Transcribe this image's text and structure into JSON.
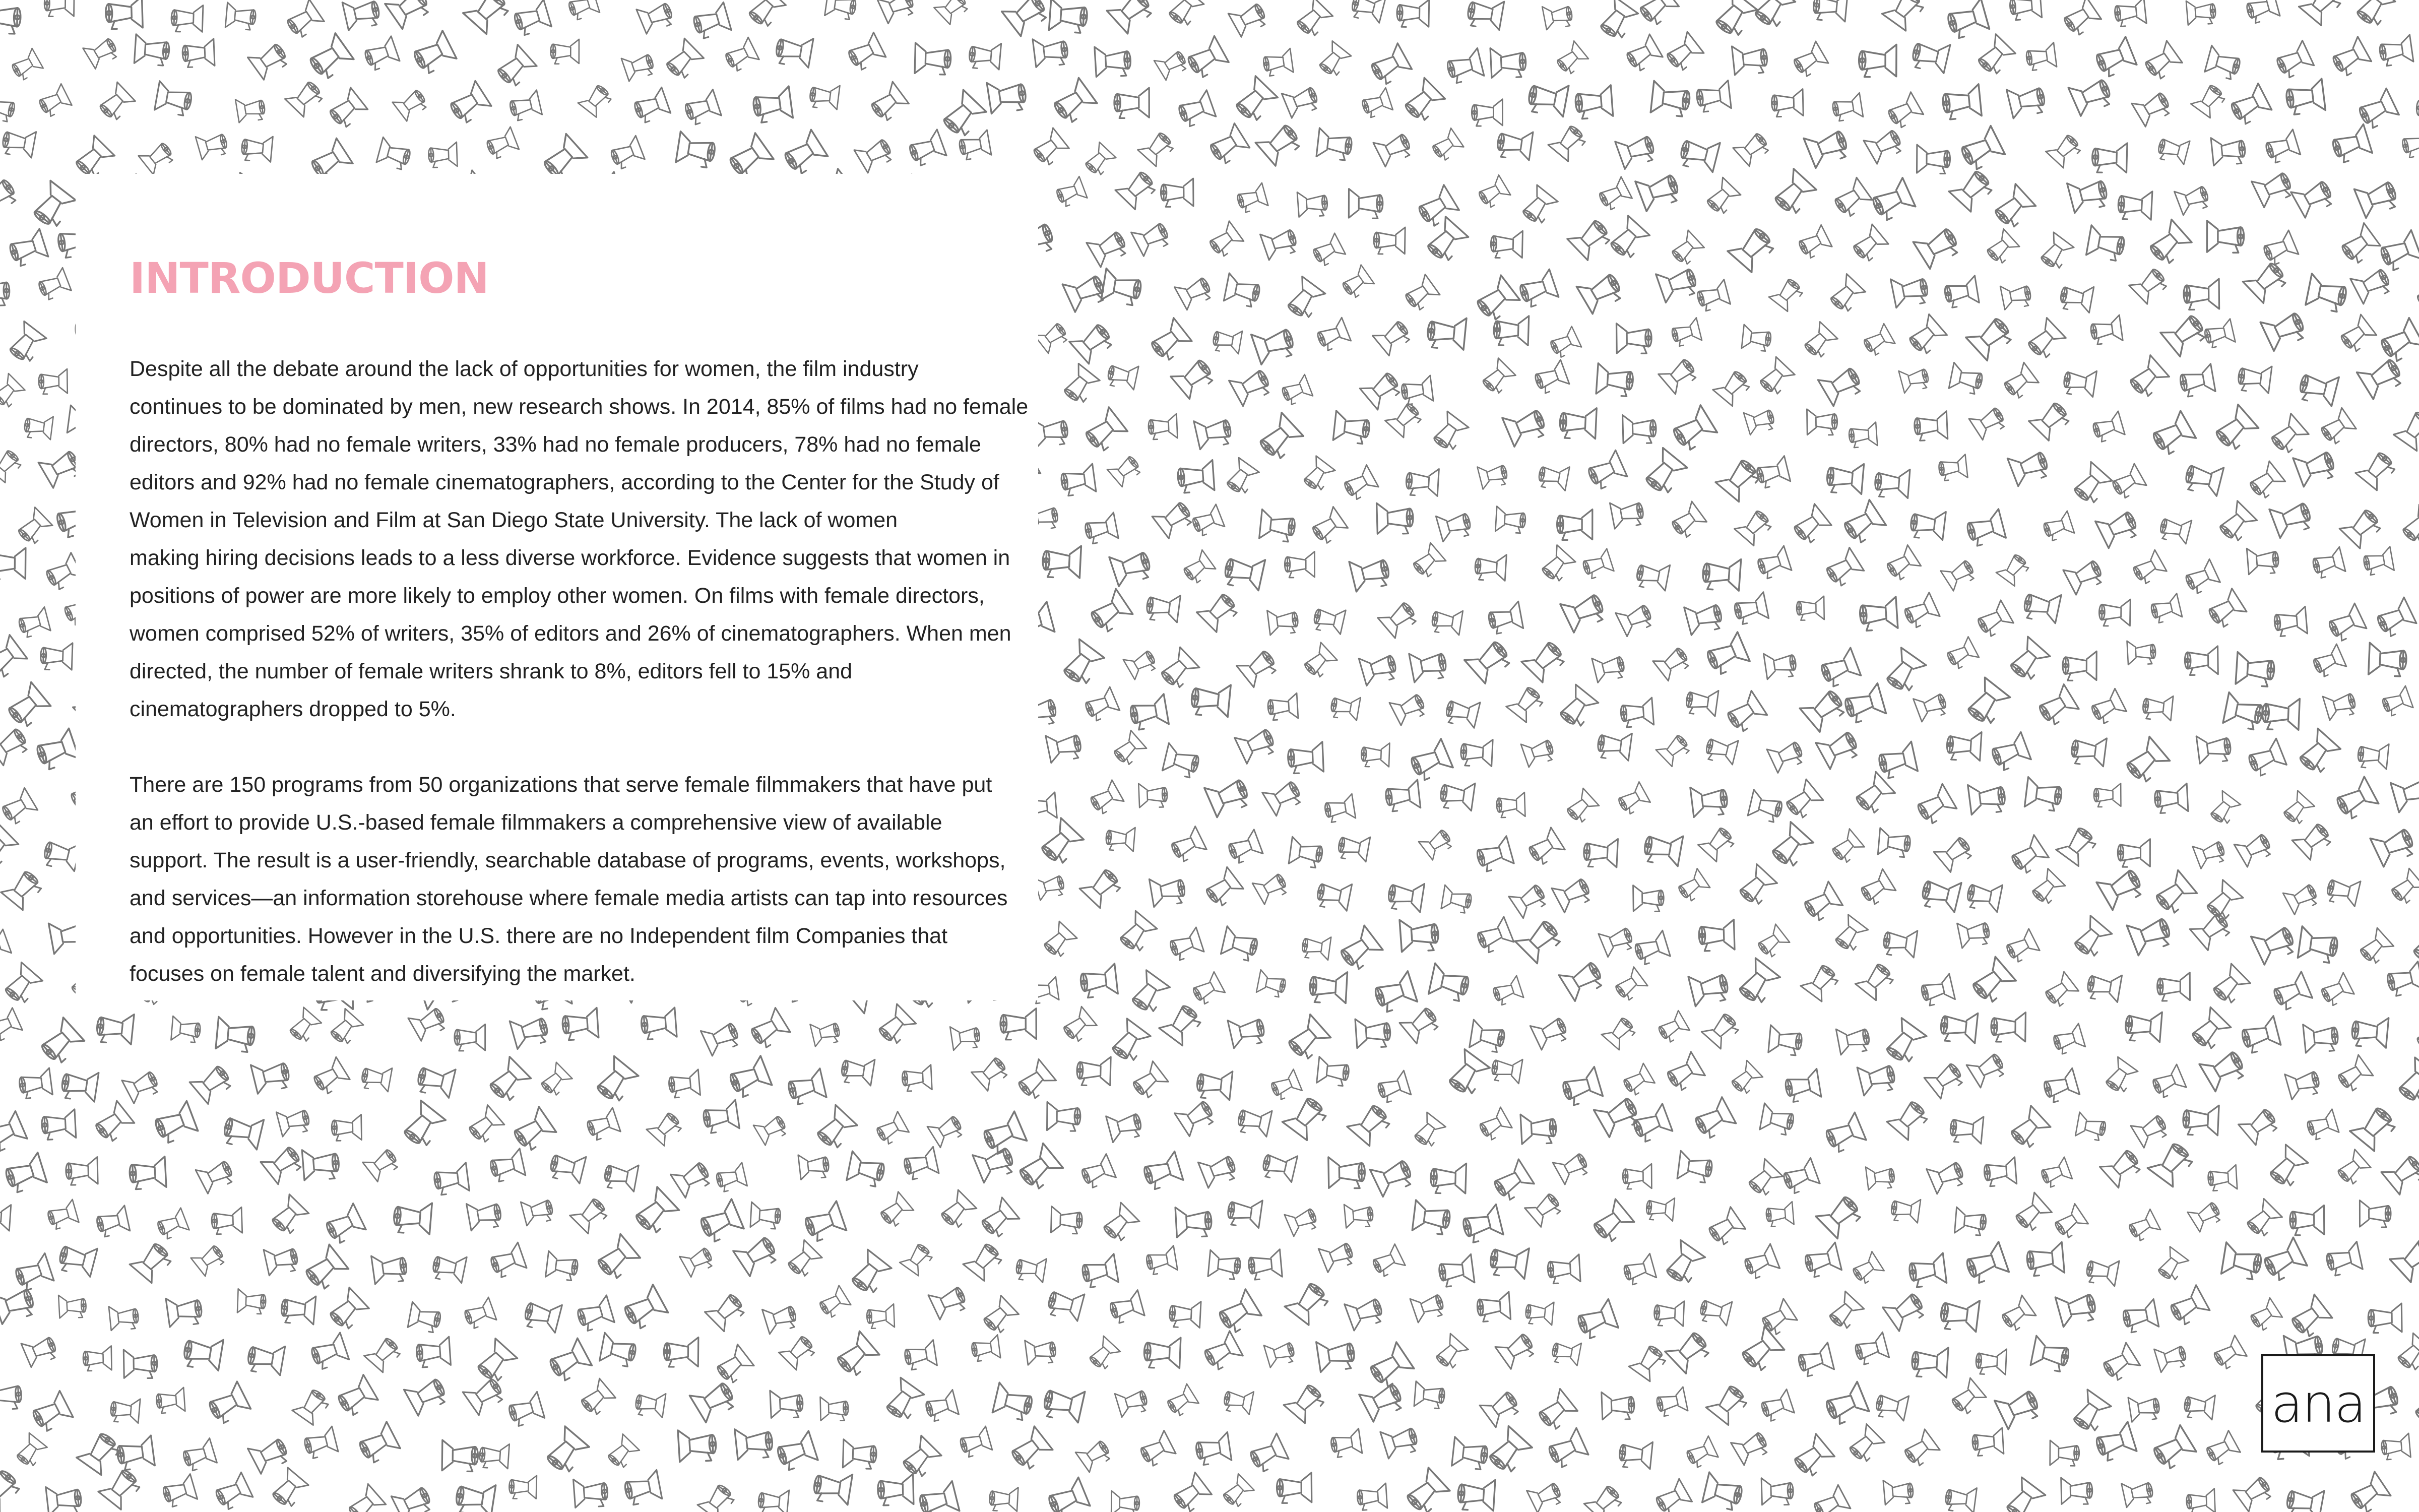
{
  "introduction": {
    "heading": "INTRODUCTION",
    "paragraphs": [
      [
        "Despite all the debate around the lack of opportunities for women, the film industry",
        "continues to be dominated by men, new research shows. In 2014, 85% of films had no female",
        "directors, 80% had no female writers, 33% had no female producers, 78% had no female",
        "editors and 92% had no female cinematographers, according to the Center for the Study of",
        "Women in Television and Film at San Diego State University. The lack of women",
        "making hiring decisions leads to a less diverse workforce. Evidence suggests that women in",
        "positions of power are more likely to employ other women. On films with female directors,",
        "women comprised 52% of writers, 35% of editors and 26% of cinematographers. When men",
        "directed, the number of female writers shrank to 8%, editors fell to 15% and",
        "cinematographers dropped to 5%."
      ],
      [
        "There are 150 programs from 50 organizations that serve female filmmakers that have put",
        "an effort to provide U.S.-based female filmmakers a comprehensive view of available",
        "support. The result is a user-friendly, searchable database of programs, events, workshops,",
        "and services—an information storehouse where female media artists can tap into resources",
        "and opportunities. However in the U.S. there are no Independent film Companies that",
        "focuses on female talent and diversifying the market."
      ]
    ]
  },
  "logo": {
    "text": "ana"
  },
  "background": {
    "icon": "megaphone-icon"
  },
  "colors": {
    "heading": "#f4a3b4",
    "body_text": "#222222",
    "pattern_stroke": "#777777",
    "logo": "#1a1a1a"
  }
}
